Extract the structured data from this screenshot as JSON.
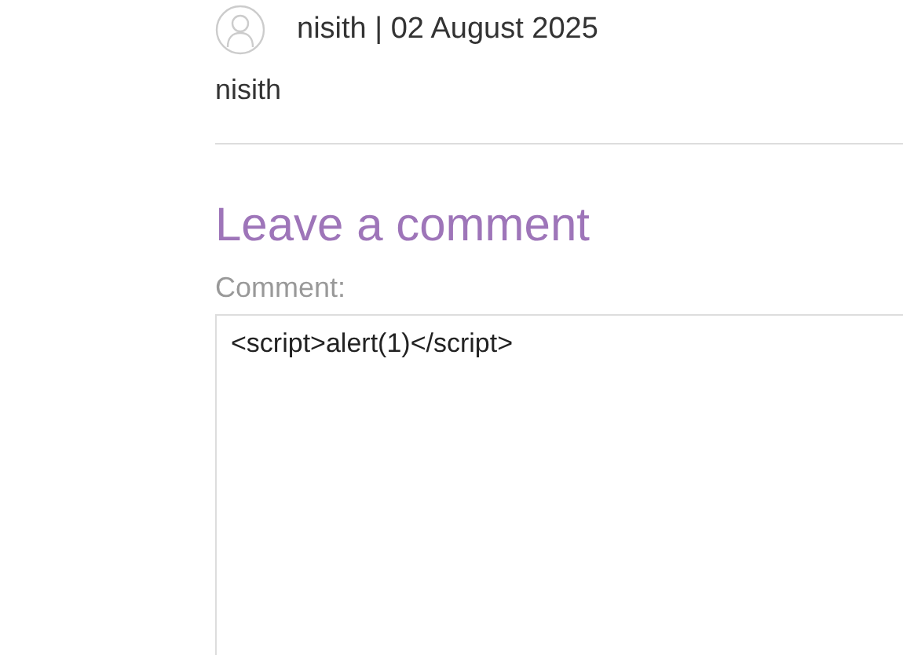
{
  "comment": {
    "author_line": "nisith | 02 August 2025",
    "body": "nisith"
  },
  "form": {
    "heading": "Leave a comment",
    "label": "Comment:",
    "value": "<script>alert(1)</script>"
  }
}
